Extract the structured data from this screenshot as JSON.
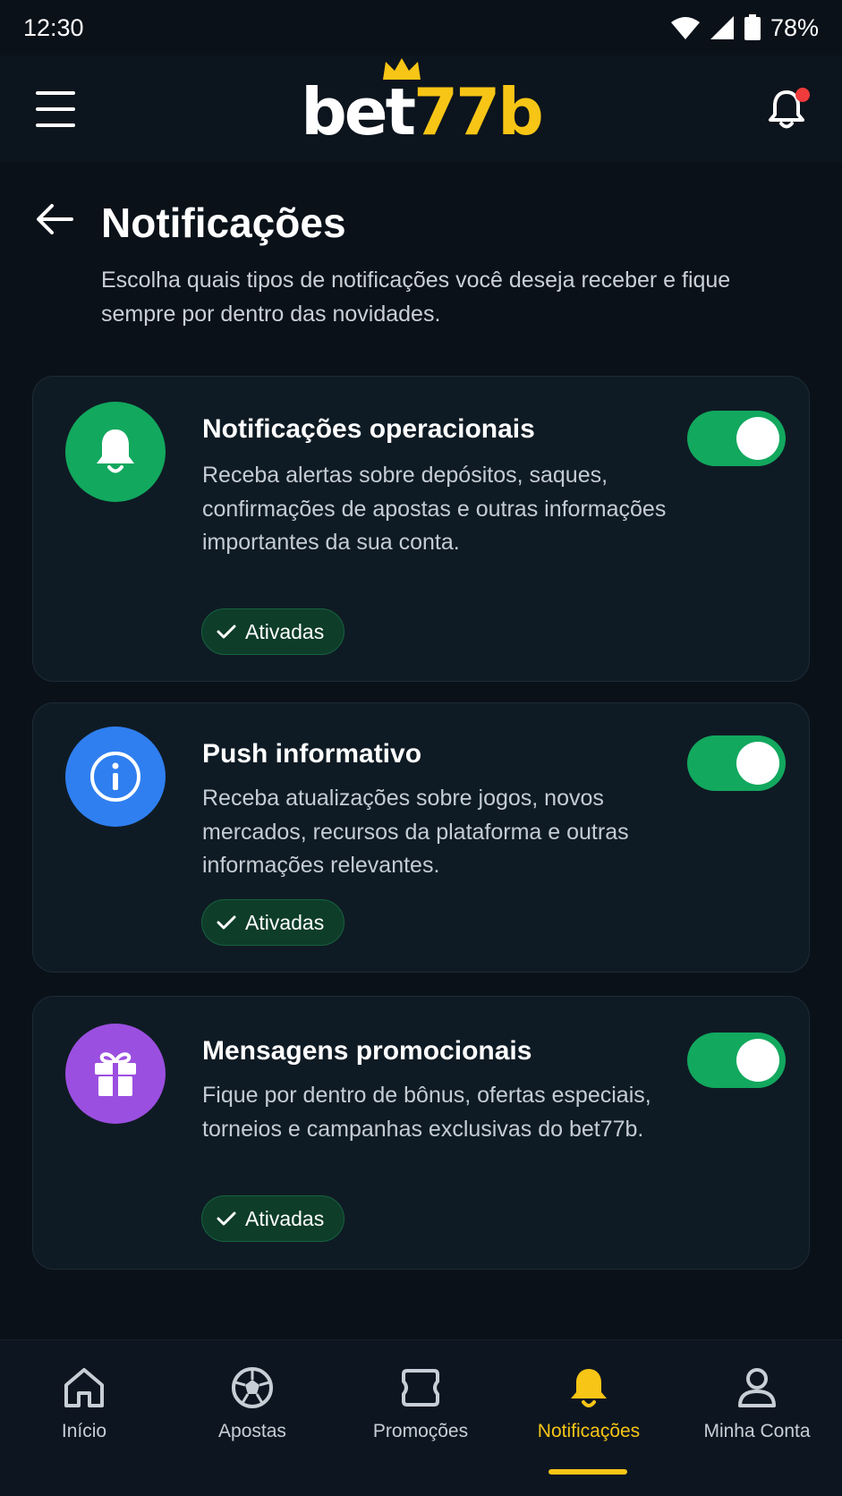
{
  "status_bar": {
    "time": "12:30",
    "battery": "78%"
  },
  "header": {
    "logo_left": "bet",
    "logo_right": "77b",
    "has_unread": true
  },
  "page": {
    "title": "Notificações",
    "subtitle": "Escolha quais tipos de notificações você deseja receber e fique sempre por dentro das novidades."
  },
  "cards": [
    {
      "title": "Notificações operacionais",
      "description": "Receba alertas sobre depósitos, saques, confirmações de apostas e outras informações importantes da sua conta.",
      "badge": "Ativadas",
      "enabled": true,
      "icon": "bell-icon",
      "color": "#12a85e"
    },
    {
      "title": "Push informativo",
      "description": "Receba atualizações sobre jogos, novos mercados, recursos da plataforma e outras informações relevantes.",
      "badge": "Ativadas",
      "enabled": true,
      "icon": "info-icon",
      "color": "#2f7ff0"
    },
    {
      "title": "Mensagens promocionais",
      "description": "Fique por dentro de bônus, ofertas especiais, torneios e campanhas exclusivas do bet77b.",
      "badge": "Ativadas",
      "enabled": true,
      "icon": "gift-icon",
      "color": "#9b4fe0"
    }
  ],
  "bottom_nav": {
    "items": [
      {
        "label": "Início",
        "icon": "home-icon"
      },
      {
        "label": "Apostas",
        "icon": "soccer-ball-icon"
      },
      {
        "label": "Promoções",
        "icon": "ticket-icon"
      },
      {
        "label": "Notificações",
        "icon": "bell-icon"
      },
      {
        "label": "Minha Conta",
        "icon": "user-icon"
      }
    ],
    "active": "Notificações"
  },
  "colors": {
    "accent": "#f7c515",
    "toggle_on": "#12a85e",
    "background": "#0a1119",
    "card": "#0f1b24"
  }
}
